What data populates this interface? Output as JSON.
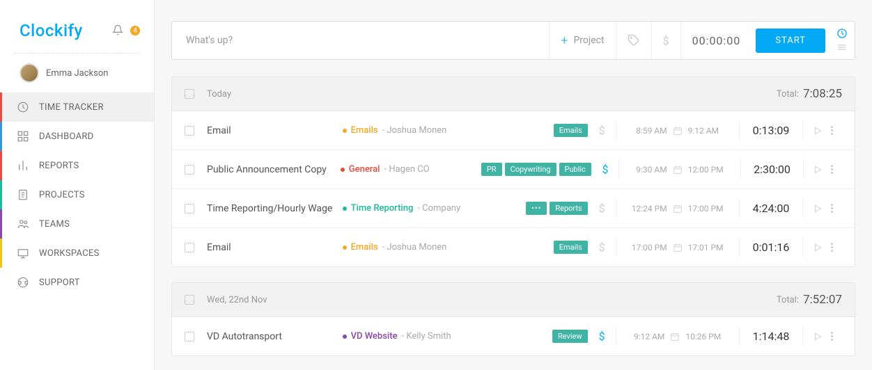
{
  "brand": "Clockify",
  "notification_count": "4",
  "user": {
    "name": "Emma Jackson"
  },
  "nav": [
    {
      "label": "TIME TRACKER",
      "stripe": "stripe-red",
      "active": true
    },
    {
      "label": "DASHBOARD",
      "stripe": "stripe-blue",
      "active": false
    },
    {
      "label": "REPORTS",
      "stripe": "stripe-red",
      "active": false
    },
    {
      "label": "PROJECTS",
      "stripe": "stripe-green",
      "active": false
    },
    {
      "label": "TEAMS",
      "stripe": "stripe-purple",
      "active": false
    },
    {
      "label": "WORKSPACES",
      "stripe": "stripe-yellow",
      "active": false
    },
    {
      "label": "SUPPORT",
      "stripe": "",
      "active": false
    }
  ],
  "entry_bar": {
    "placeholder": "What's up?",
    "project_label": "Project",
    "timer": "00:00:00",
    "start_label": "START"
  },
  "groups": [
    {
      "label": "Today",
      "total_label": "Total:",
      "total": "7:08:25",
      "entries": [
        {
          "desc": "Email",
          "dot": "dot-orange",
          "proj_color": "proj-orange",
          "project": "Emails",
          "client": "Joshua Monen",
          "tags": [
            "Emails"
          ],
          "more_tags": false,
          "billable": false,
          "start": "8:59 AM",
          "end": "9:12 AM",
          "duration": "0:13:09"
        },
        {
          "desc": "Public Announcement Copy",
          "dot": "dot-red",
          "proj_color": "proj-red",
          "project": "General",
          "client": "Hagen CO",
          "tags": [
            "PR",
            "Copywriting",
            "Public"
          ],
          "more_tags": false,
          "billable": true,
          "start": "9:30 AM",
          "end": "12:00 PM",
          "duration": "2:30:00"
        },
        {
          "desc": "Time Reporting/Hourly Wage",
          "dot": "dot-teal",
          "proj_color": "proj-teal",
          "project": "Time Reporting",
          "client": "Company",
          "tags": [
            "Reports"
          ],
          "more_tags": true,
          "billable": false,
          "start": "12:24 PM",
          "end": "17:00 PM",
          "duration": "4:24:00"
        },
        {
          "desc": "Email",
          "dot": "dot-orange",
          "proj_color": "proj-orange",
          "project": "Emails",
          "client": "Joshua Monen",
          "tags": [
            "Emails"
          ],
          "more_tags": false,
          "billable": false,
          "start": "17:00 PM",
          "end": "17:01 PM",
          "duration": "0:01:16"
        }
      ]
    },
    {
      "label": "Wed, 22nd Nov",
      "total_label": "Total:",
      "total": "7:52:07",
      "entries": [
        {
          "desc": "VD Autotransport",
          "dot": "dot-purple",
          "proj_color": "proj-purple",
          "project": "VD Website",
          "client": "Kelly Smith",
          "tags": [
            "Review"
          ],
          "more_tags": false,
          "billable": true,
          "start": "9:12 AM",
          "end": "10:26 PM",
          "duration": "1:14:48"
        }
      ]
    }
  ]
}
